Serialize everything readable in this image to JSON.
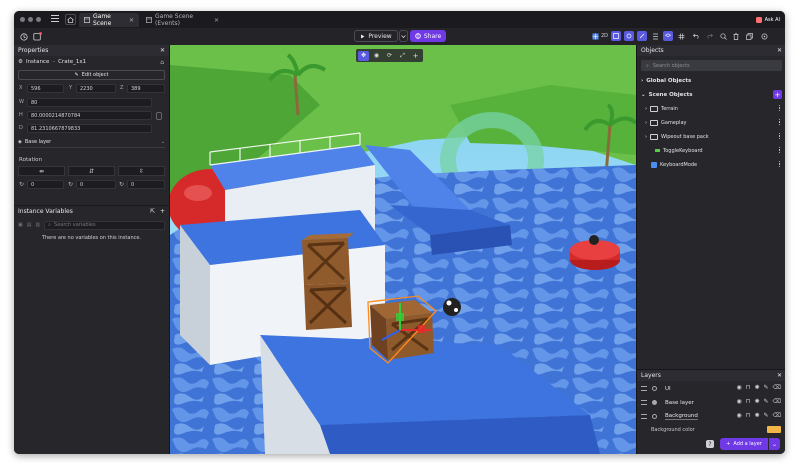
{
  "titlebar": {
    "tabs": [
      {
        "label": "Game Scene",
        "active": true
      },
      {
        "label": "Game Scene (Events)",
        "active": false
      }
    ],
    "ask_ai": "Ask AI"
  },
  "toolbar": {
    "preview_label": "Preview",
    "share_label": "Share",
    "grid_label": "2D"
  },
  "properties": {
    "title": "Properties",
    "instance_label": "Instance",
    "instance_name": "Crate_1x1",
    "edit_object": "Edit object",
    "x_label": "X",
    "x_value": "596",
    "y_label": "Y",
    "y_value": "2230",
    "z_label": "Z",
    "z_value": "389",
    "w_label": "W",
    "w_value": "80",
    "h_label": "H",
    "h_value": "80.0000214870784",
    "d_label": "D",
    "d_value": "81.2310667879833",
    "layer_value": "Base layer",
    "rotation_label": "Rotation",
    "rot_x": "0",
    "rot_y": "0",
    "rot_z": "0"
  },
  "instance_variables": {
    "title": "Instance Variables",
    "search_placeholder": "Search variables",
    "empty_message": "There are no variables on this instance."
  },
  "objects": {
    "title": "Objects",
    "search_placeholder": "Search objects",
    "global_label": "Global Objects",
    "scene_label": "Scene Objects",
    "items": [
      {
        "label": "Terrain",
        "type": "folder"
      },
      {
        "label": "Gameplay",
        "type": "folder"
      },
      {
        "label": "Wipeout base pack",
        "type": "folder"
      },
      {
        "label": "ToggleKeyboard",
        "type": "object"
      },
      {
        "label": "KeyboardMode",
        "type": "object"
      }
    ]
  },
  "layers": {
    "title": "Layers",
    "items": [
      {
        "label": "UI"
      },
      {
        "label": "Base layer"
      },
      {
        "label": "Background"
      }
    ],
    "background_color_label": "Background color",
    "add_layer": "Add a layer"
  },
  "colors": {
    "accent": "#6f39e6",
    "panel": "#26262b",
    "bg_color_swatch": "#f2b646"
  }
}
